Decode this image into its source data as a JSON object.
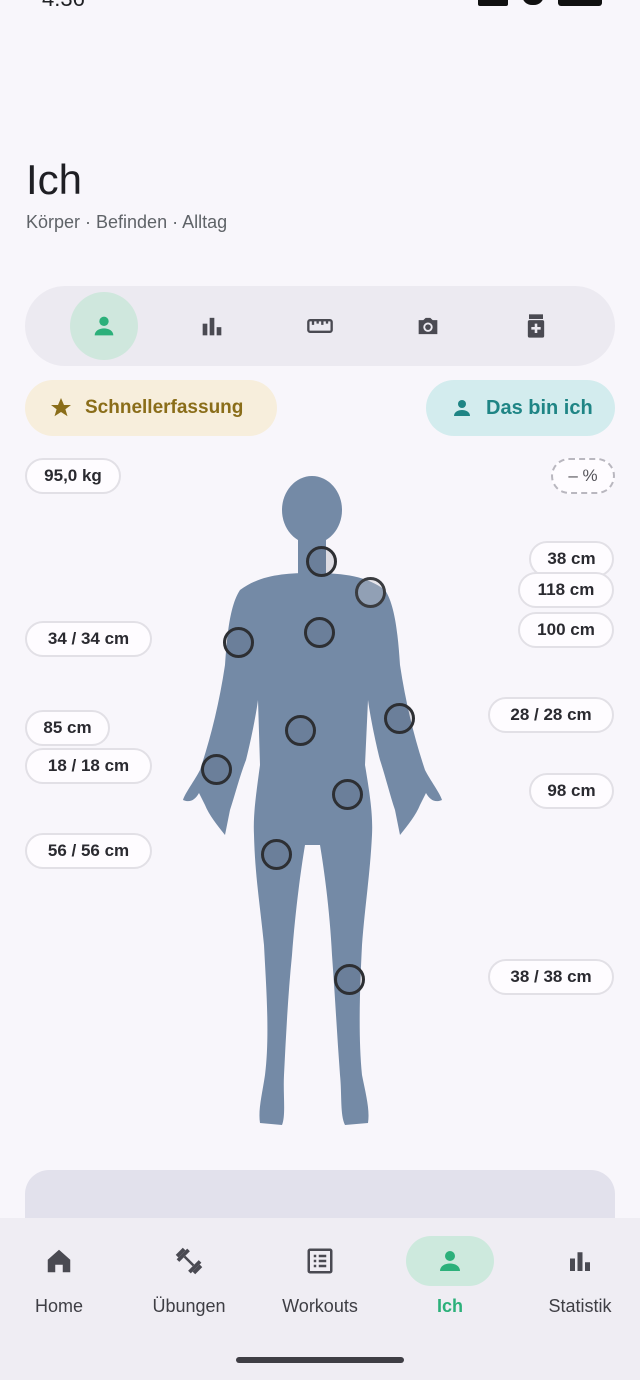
{
  "status_bar": {
    "time": "4:36"
  },
  "header": {
    "title": "Ich",
    "subtitle": "Körper · Befinden · Alltag"
  },
  "tabs": [
    {
      "icon": "person-icon",
      "active": true
    },
    {
      "icon": "bar-chart-icon",
      "active": false
    },
    {
      "icon": "ruler-icon",
      "active": false
    },
    {
      "icon": "camera-icon",
      "active": false
    },
    {
      "icon": "medication-icon",
      "active": false
    }
  ],
  "actions": {
    "quick_entry_label": "Schnellerfassung",
    "me_label": "Das bin ich"
  },
  "measurements": {
    "weight": "95,0 kg",
    "body_fat": "– %",
    "neck": "38 cm",
    "chest": "118 cm",
    "waist": "100 cm",
    "upper_arm": "34 / 34 cm",
    "forearm": "28 / 28 cm",
    "belly": "85 cm",
    "wrist": "18 / 18 cm",
    "hip": "98 cm",
    "thigh": "56 / 56 cm",
    "calf": "38 / 38 cm"
  },
  "nav": [
    {
      "label": "Home",
      "icon": "home-icon",
      "active": false
    },
    {
      "label": "Übungen",
      "icon": "dumbbell-icon",
      "active": false
    },
    {
      "label": "Workouts",
      "icon": "list-icon",
      "active": false
    },
    {
      "label": "Ich",
      "icon": "person-icon",
      "active": true
    },
    {
      "label": "Statistik",
      "icon": "bar-chart-icon",
      "active": false
    }
  ],
  "colors": {
    "accent_green": "#2cb07a",
    "accent_teal": "#1f8585",
    "accent_gold": "#8a6d19",
    "figure": "#748aa6"
  }
}
